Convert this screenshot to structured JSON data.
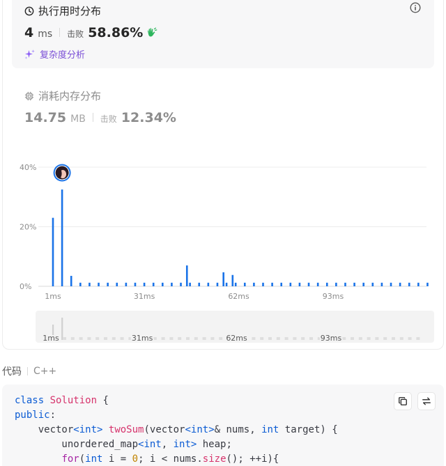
{
  "runtime": {
    "title": "执行用时分布",
    "value": "4",
    "unit": "ms",
    "beats_label": "击败",
    "beats_pct": "58.86%",
    "complexity_label": "复杂度分析"
  },
  "memory": {
    "title": "消耗内存分布",
    "value": "14.75",
    "unit": "MB",
    "beats_label": "击败",
    "beats_pct": "12.34%"
  },
  "icons": {
    "runtime": "clock-icon",
    "info": "info-icon",
    "beats": "clapping-hands-icon",
    "complexity": "sparkle-icon",
    "memory": "chip-icon",
    "avatar": "user-avatar",
    "copy": "copy-icon",
    "swap": "swap-icon"
  },
  "colors": {
    "bar": "#1a73e8",
    "accent_purple": "#7b4fd6",
    "clap_green": "#2db55d",
    "panel_bg": "#f7f7f8"
  },
  "chart_data": {
    "type": "bar",
    "y_ticks": [
      "40%",
      "20%",
      "0%"
    ],
    "x_ticks": [
      "1ms",
      "31ms",
      "62ms",
      "93ms"
    ],
    "ylim": [
      0,
      40
    ],
    "grid": true,
    "highlighted_bin": 4,
    "x": [
      1,
      4,
      7,
      10,
      13,
      16,
      19,
      22,
      25,
      28,
      31,
      34,
      37,
      40,
      43,
      46,
      49,
      52,
      55,
      58,
      61,
      64,
      67,
      70,
      73,
      76,
      79,
      82,
      85,
      88,
      91,
      94,
      97,
      100,
      103,
      106,
      109,
      112,
      115,
      118,
      121,
      124
    ],
    "values": [
      23,
      32.5,
      3.5,
      1.2,
      1.2,
      1.2,
      1.2,
      1.2,
      1.2,
      1.2,
      1.2,
      1.2,
      1.2,
      1.2,
      1.2,
      1.2,
      1.2,
      1.2,
      1.2,
      1.2,
      1.2,
      1.2,
      1.2,
      1.2,
      1.2,
      1.2,
      1.2,
      1.2,
      1.2,
      1.2,
      1.2,
      1.2,
      1.2,
      1.2,
      1.2,
      1.2,
      1.2,
      1.2,
      1.2,
      1.2,
      1.2,
      1.2
    ],
    "extra_bars": [
      {
        "x": 45,
        "value": 7
      },
      {
        "x": 57,
        "value": 4.7
      },
      {
        "x": 60,
        "value": 3.8
      }
    ]
  },
  "navigator": {
    "ticks": [
      "1ms",
      "31ms",
      "62ms",
      "93ms"
    ]
  },
  "code": {
    "title": "代码",
    "language": "C++",
    "lines": [
      [
        {
          "t": "class ",
          "c": "kw"
        },
        {
          "t": "Solution",
          "c": "fn"
        },
        {
          "t": " {",
          "c": "pl"
        }
      ],
      [
        {
          "t": "public",
          "c": "kw"
        },
        {
          "t": ":",
          "c": "pl"
        }
      ],
      [
        {
          "t": "    vector",
          "c": "pl"
        },
        {
          "t": "<int>",
          "c": "ty"
        },
        {
          "t": " ",
          "c": "pl"
        },
        {
          "t": "twoSum",
          "c": "fn"
        },
        {
          "t": "(vector",
          "c": "pl"
        },
        {
          "t": "<int>",
          "c": "ty"
        },
        {
          "t": "& nums, ",
          "c": "pl"
        },
        {
          "t": "int",
          "c": "ty"
        },
        {
          "t": " target) {",
          "c": "pl"
        }
      ],
      [
        {
          "t": "        unordered_map",
          "c": "pl"
        },
        {
          "t": "<int",
          "c": "ty"
        },
        {
          "t": ", ",
          "c": "pl"
        },
        {
          "t": "int>",
          "c": "ty"
        },
        {
          "t": " heap;",
          "c": "pl"
        }
      ],
      [
        {
          "t": "        ",
          "c": "pl"
        },
        {
          "t": "for",
          "c": "kw2"
        },
        {
          "t": "(",
          "c": "pl"
        },
        {
          "t": "int",
          "c": "ty"
        },
        {
          "t": " i = ",
          "c": "pl"
        },
        {
          "t": "0",
          "c": "num"
        },
        {
          "t": "; i < nums.",
          "c": "pl"
        },
        {
          "t": "size",
          "c": "fn"
        },
        {
          "t": "(); ++i){",
          "c": "pl"
        }
      ]
    ]
  }
}
